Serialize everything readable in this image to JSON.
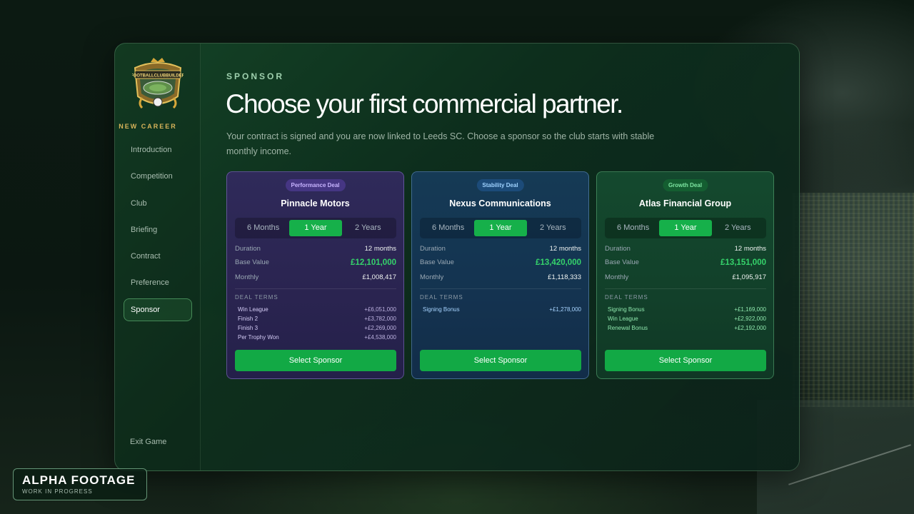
{
  "sidebar": {
    "section_label": "NEW CAREER",
    "items": [
      {
        "label": "Introduction"
      },
      {
        "label": "Competition"
      },
      {
        "label": "Club"
      },
      {
        "label": "Briefing"
      },
      {
        "label": "Contract"
      },
      {
        "label": "Preference"
      },
      {
        "label": "Sponsor",
        "active": true
      }
    ],
    "exit_label": "Exit Game"
  },
  "main": {
    "eyebrow": "SPONSOR",
    "title": "Choose your first commercial partner.",
    "description": "Your contract is signed and you are now linked to Leeds SC. Choose a sponsor so the club starts with stable monthly income."
  },
  "cards": [
    {
      "badge": "Performance Deal",
      "name": "Pinnacle Motors",
      "options": [
        "6 Months",
        "1 Year",
        "2 Years"
      ],
      "selected_option": "1 Year",
      "duration_label": "Duration",
      "duration": "12 months",
      "base_label": "Base Value",
      "base_value": "£12,101,000",
      "monthly_label": "Monthly",
      "monthly": "£1,008,417",
      "terms_label": "DEAL TERMS",
      "terms": [
        {
          "name": "Win League",
          "value": "+£6,051,000"
        },
        {
          "name": "Finish 2",
          "value": "+£3,782,000"
        },
        {
          "name": "Finish 3",
          "value": "+£2,269,000"
        },
        {
          "name": "Per Trophy Won",
          "value": "+£4,538,000"
        }
      ],
      "button": "Select Sponsor"
    },
    {
      "badge": "Stability Deal",
      "name": "Nexus Communications",
      "options": [
        "6 Months",
        "1 Year",
        "2 Years"
      ],
      "selected_option": "1 Year",
      "duration_label": "Duration",
      "duration": "12 months",
      "base_label": "Base Value",
      "base_value": "£13,420,000",
      "monthly_label": "Monthly",
      "monthly": "£1,118,333",
      "terms_label": "DEAL TERMS",
      "terms": [
        {
          "name": "Signing Bonus",
          "value": "+£1,278,000"
        }
      ],
      "button": "Select Sponsor"
    },
    {
      "badge": "Growth Deal",
      "name": "Atlas Financial Group",
      "options": [
        "6 Months",
        "1 Year",
        "2 Years"
      ],
      "selected_option": "1 Year",
      "duration_label": "Duration",
      "duration": "12 months",
      "base_label": "Base Value",
      "base_value": "£13,151,000",
      "monthly_label": "Monthly",
      "monthly": "£1,095,917",
      "terms_label": "DEAL TERMS",
      "terms": [
        {
          "name": "Signing Bonus",
          "value": "+£1,169,000"
        },
        {
          "name": "Win League",
          "value": "+£2,922,000"
        },
        {
          "name": "Renewal Bonus",
          "value": "+£2,192,000"
        }
      ],
      "button": "Select Sponsor"
    }
  ],
  "watermark": {
    "title": "ALPHA FOOTAGE",
    "subtitle": "WORK IN PROGRESS"
  },
  "colors": {
    "accent_green": "#16b04a",
    "value_green": "#35d36b",
    "career_gold": "#d8b45a"
  },
  "logo": {
    "icon": "club-crest-icon",
    "text": "FOOTBALLCLUBBUILDER"
  }
}
